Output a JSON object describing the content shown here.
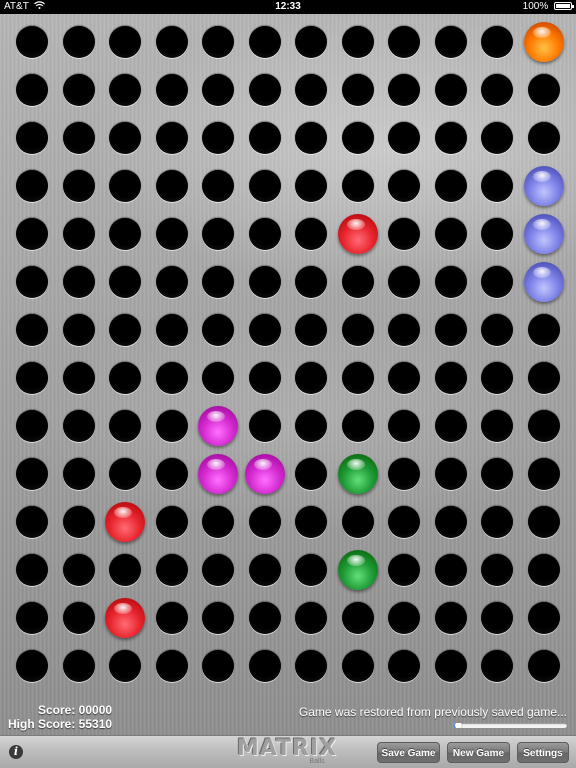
{
  "status_bar": {
    "carrier": "AT&T",
    "time": "12:33",
    "battery": "100%",
    "battery_level": 1.0
  },
  "board": {
    "columns": 12,
    "rows": 14,
    "balls": [
      {
        "row": 0,
        "col": 11,
        "color": "orange"
      },
      {
        "row": 3,
        "col": 11,
        "color": "blue"
      },
      {
        "row": 4,
        "col": 7,
        "color": "red"
      },
      {
        "row": 4,
        "col": 11,
        "color": "blue"
      },
      {
        "row": 5,
        "col": 11,
        "color": "blue"
      },
      {
        "row": 8,
        "col": 4,
        "color": "magenta"
      },
      {
        "row": 9,
        "col": 4,
        "color": "magenta"
      },
      {
        "row": 9,
        "col": 5,
        "color": "magenta"
      },
      {
        "row": 9,
        "col": 7,
        "color": "green"
      },
      {
        "row": 10,
        "col": 2,
        "color": "red"
      },
      {
        "row": 11,
        "col": 7,
        "color": "green"
      },
      {
        "row": 12,
        "col": 2,
        "color": "red"
      }
    ]
  },
  "ball_colors": {
    "orange": "#ff7a00",
    "blue": "#7b7fe6",
    "red": "#e8252e",
    "magenta": "#d42ad0",
    "green": "#1e9a35"
  },
  "score": {
    "score_text": "Score: 00000",
    "high_score_text": "High Score: 55310"
  },
  "message": "Game was restored from previously saved game...",
  "progress": 0.04,
  "toolbar": {
    "info_icon": "info-icon",
    "logo_text": "MATRIX",
    "logo_subtext": "Balls",
    "save_label": "Save Game",
    "new_label": "New Game",
    "settings_label": "Settings"
  }
}
